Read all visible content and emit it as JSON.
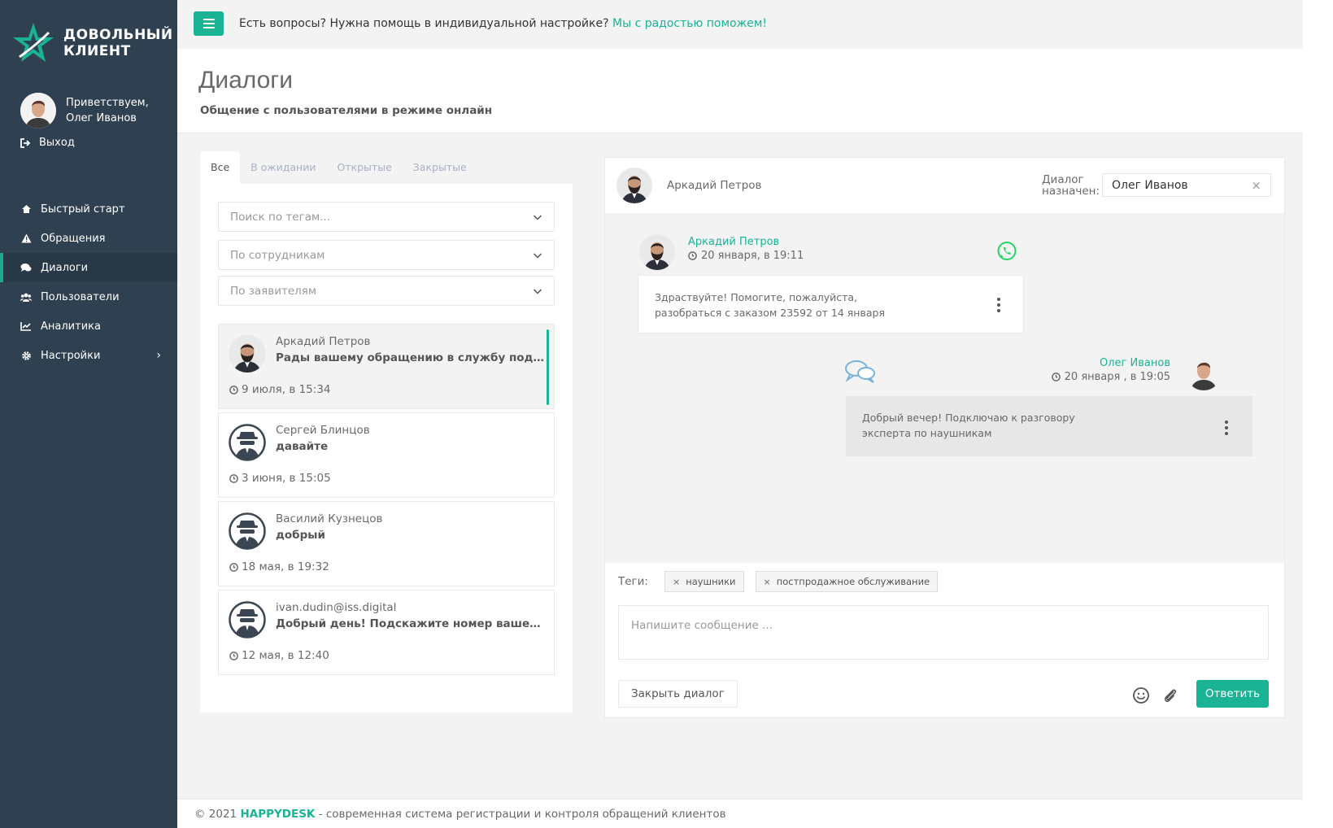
{
  "brand": {
    "line1": "Довольный",
    "line2": "клиент",
    "accent": "#1ab394"
  },
  "user": {
    "greeting_line1": "Приветствуем,",
    "greeting_line2": "Олег Иванов",
    "logout": "Выход"
  },
  "menu": [
    {
      "label": "Быстрый старт",
      "icon": "home-icon"
    },
    {
      "label": "Обращения",
      "icon": "warning-icon"
    },
    {
      "label": "Диалоги",
      "icon": "comments-icon",
      "active": true
    },
    {
      "label": "Пользователи",
      "icon": "users-icon"
    },
    {
      "label": "Аналитика",
      "icon": "chart-icon"
    },
    {
      "label": "Настройки",
      "icon": "gear-icon"
    }
  ],
  "topbar": {
    "text": "Есть вопросы? Нужна помощь в индивидуальной настройке?",
    "link": "Мы с радостью поможем!"
  },
  "page": {
    "title": "Диалоги",
    "subtitle": "Общение с пользователями в режиме онлайн"
  },
  "tabs": [
    "Все",
    "В ожидании",
    "Открытые",
    "Закрытые"
  ],
  "filters": {
    "tags": "Поиск по тегам...",
    "staff": "По сотрудникам",
    "applicants": "По заявителям"
  },
  "dialogs": [
    {
      "name": "Аркадий Петров",
      "message": "Рады вашему обращению в службу поддержки",
      "time": "9 июля, в 15:34"
    },
    {
      "name": "Сергей Блинцов",
      "message": "давайте",
      "time": "3 июня, в 15:05"
    },
    {
      "name": "Василий Кузнецов",
      "message": "добрый",
      "time": "18 мая, в 19:32"
    },
    {
      "name": "ivan.dudin@iss.digital",
      "message": "Добрый день! Подскажите номер вашего заказа",
      "time": "12 мая, в 12:40"
    }
  ],
  "chat": {
    "contact": "Аркадий Петров",
    "assigned_label_1": "Диалог",
    "assigned_label_2": "назначен:",
    "assigned_to": "Олег Иванов",
    "messages": [
      {
        "author": "Аркадий Петров",
        "time": "20 января, в 19:11",
        "line1": "Здраствуйте!   Помогите, пожалуйста,",
        "line2": "разобраться с заказом 23592 от 14 января",
        "channel": "whatsapp-icon"
      },
      {
        "author": "Олег Иванов",
        "time": "20 января , в 19:05",
        "line1": "Добрый вечер! Подключаю к разговору",
        "line2": "эксперта по наушникам",
        "channel": "chat-bubbles-icon"
      }
    ],
    "tags_label": "Теги:",
    "tags": [
      "наушники",
      "постпродажное обслуживание"
    ],
    "compose_placeholder": "Напишите сообщение ...",
    "close_button": "Закрыть диалог",
    "reply_button": "Ответить"
  },
  "footer": {
    "prefix": "© 2021",
    "brand": "HAPPYDESK",
    "text": "- современная система регистрации и  контроля обращений клиентов"
  }
}
